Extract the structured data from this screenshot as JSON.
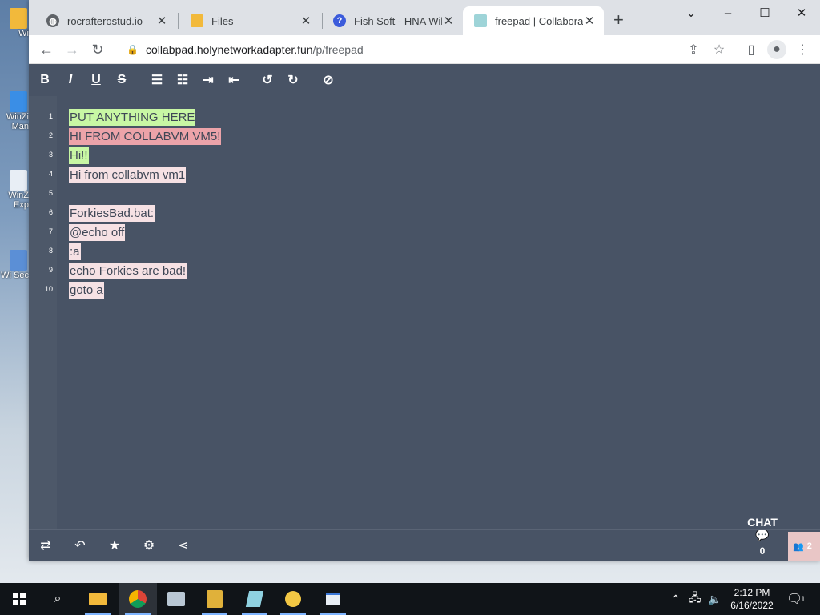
{
  "desktop": {
    "icons": [
      {
        "label": "Wi"
      },
      {
        "label": "WinZi Man"
      },
      {
        "label": "WinZ Exp"
      },
      {
        "label": "Wi Sec"
      }
    ]
  },
  "browser": {
    "tabs": [
      {
        "title": "rocrafterostud.io",
        "icon": "globe-icon"
      },
      {
        "title": "Files",
        "icon": "folder-icon"
      },
      {
        "title": "Fish Soft - HNA Wiki",
        "icon": "help-icon"
      },
      {
        "title": "freepad | Collaborative",
        "icon": "notepad-icon",
        "active": true
      }
    ],
    "url_host": "collabpad.holynetworkadapter.fun",
    "url_path": "/p/freepad"
  },
  "pad": {
    "toolbar": [
      "B",
      "I",
      "U",
      "S"
    ],
    "line_numbers": [
      "1",
      "2",
      "3",
      "4",
      "5",
      "6",
      "7",
      "8",
      "9",
      "10"
    ],
    "lines": [
      {
        "text": "PUT ANYTHING HERE",
        "color": "#c8f7a4"
      },
      {
        "text": "HI FROM COLLABVM VM5!",
        "color": "#eca3a9"
      },
      {
        "text": "Hi!!",
        "color": "#c8f7a4"
      },
      {
        "text": "Hi from collabvm vm1",
        "color": "#f6e1e4"
      },
      {
        "text": "",
        "color": ""
      },
      {
        "text": "ForkiesBad.bat:",
        "color": "#f6e1e4"
      },
      {
        "text": "@echo off",
        "color": "#f6e1e4"
      },
      {
        "text": ":a",
        "color": "#f6e1e4"
      },
      {
        "text": "echo Forkies are bad!",
        "color": "#f6e1e4"
      },
      {
        "text": "goto a",
        "color": "#f6e1e4"
      }
    ],
    "chat": {
      "label": "CHAT",
      "count": "0"
    },
    "users_count": "2"
  },
  "taskbar": {
    "time": "2:12 PM",
    "date": "6/16/2022",
    "notification_count": "1"
  }
}
